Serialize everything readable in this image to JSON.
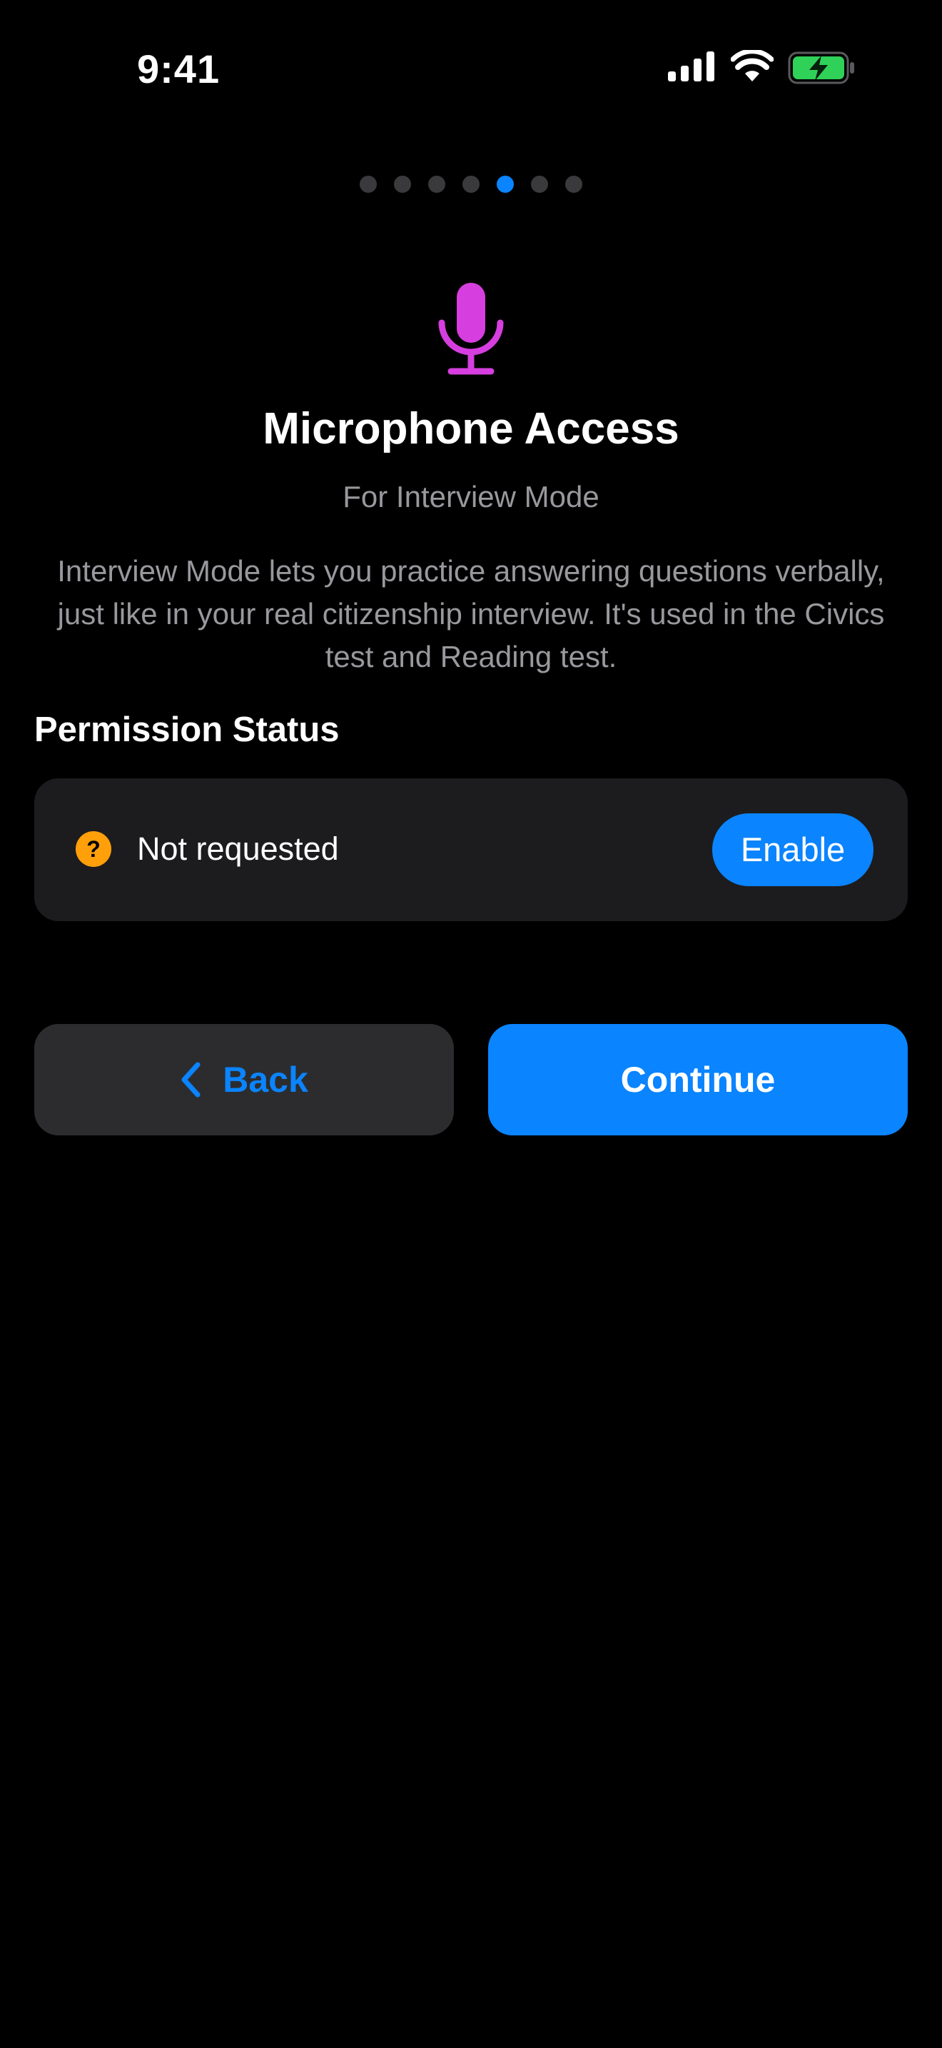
{
  "status_bar": {
    "time": "9:41",
    "icons": [
      "cellular-signal-icon",
      "wifi-icon",
      "battery-charging-icon"
    ],
    "battery_color": "#30d158"
  },
  "pager": {
    "total": 7,
    "active_index": 4,
    "active_color": "#0a84ff",
    "inactive_color": "#3a3a3c"
  },
  "hero": {
    "icon": "microphone-icon",
    "icon_color": "#d63ee0",
    "title": "Microphone Access",
    "subtitle": "For Interview Mode",
    "description": "Interview Mode lets you practice answering questions verbally, just like in your real citizenship interview. It's used in the Civics test and Reading test."
  },
  "permission": {
    "heading": "Permission Status",
    "status_icon": "question-mark-icon",
    "status_icon_color": "#ff9f0a",
    "status_icon_glyph": "?",
    "status_text": "Not requested",
    "enable_label": "Enable"
  },
  "navigation": {
    "back_label": "Back",
    "back_icon": "chevron-left-icon",
    "continue_label": "Continue"
  },
  "colors": {
    "background": "#000000",
    "card": "#1c1c1e",
    "secondary_button": "#2c2c2e",
    "accent": "#0a84ff",
    "secondary_text": "#98989d"
  }
}
